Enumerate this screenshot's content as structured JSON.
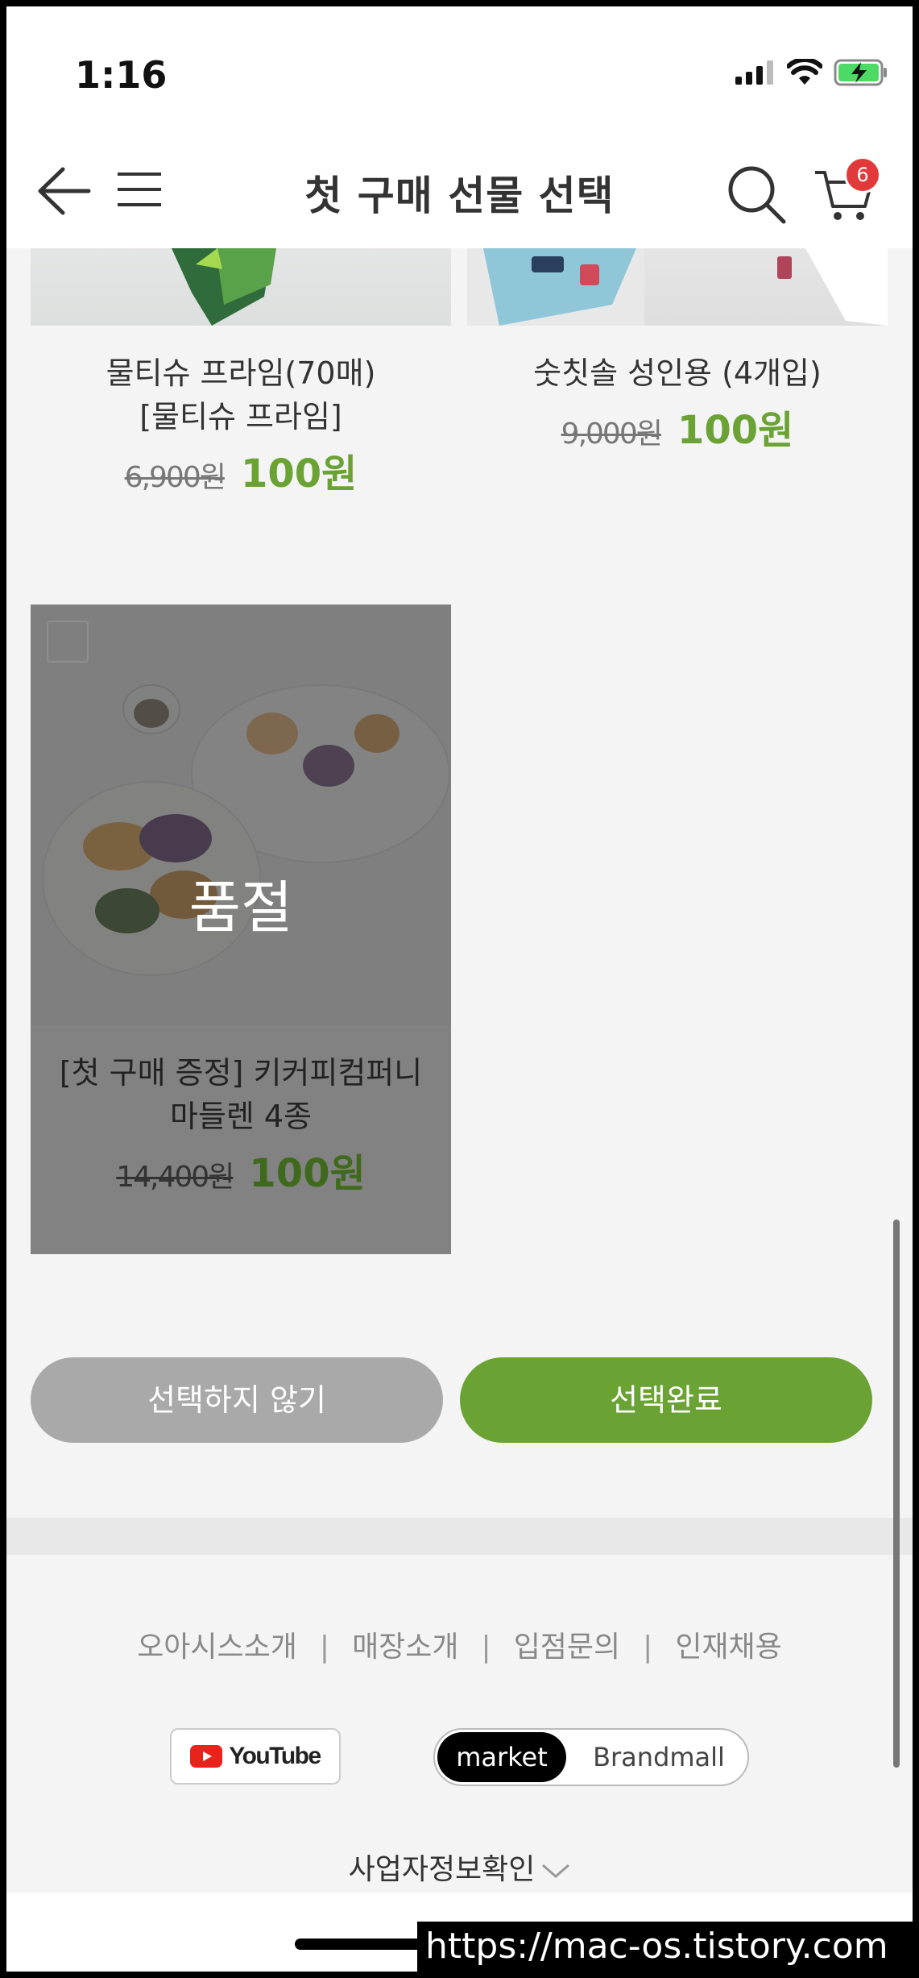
{
  "status_bar": {
    "time": "1:16"
  },
  "header": {
    "title": "첫 구매 선물 선택",
    "cart_count": "6"
  },
  "products": [
    {
      "name_line1": "물티슈 프라임(70매)",
      "name_line2": "[물티슈 프라임]",
      "old_price": "6,900원",
      "new_price": "100원"
    },
    {
      "name_line1": "숫칫솔 성인용 (4개입)",
      "old_price": "9,000원",
      "new_price": "100원"
    },
    {
      "name_line1": "[첫 구매 증정] 키커피컴퍼니",
      "name_line2": "마들렌 4종",
      "old_price": "14,400원",
      "new_price": "100원",
      "status": "품절"
    }
  ],
  "buttons": {
    "skip": "선택하지 않기",
    "done": "선택완료"
  },
  "footer": {
    "links": [
      "오아시스소개",
      "매장소개",
      "입점문의",
      "인재채용"
    ],
    "youtube": "YouTube",
    "toggle": {
      "market": "market",
      "brandmall": "Brandmall"
    },
    "biz_info": "사업자정보확인"
  },
  "watermark": "https://mac-os.tistory.com",
  "colors": {
    "accent": "#6aa234",
    "badge": "#e23a3a",
    "disabled": "#a9a9a9"
  }
}
